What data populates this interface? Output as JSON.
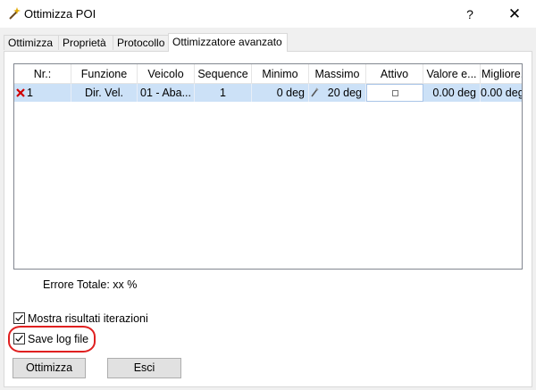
{
  "window": {
    "title": "Ottimizza POI",
    "help_glyph": "?",
    "close_glyph": "✕",
    "icon": "wand-icon"
  },
  "tabs": [
    {
      "label": "Ottimizza",
      "active": false
    },
    {
      "label": "Proprietà",
      "active": false
    },
    {
      "label": "Protocollo",
      "active": false
    },
    {
      "label": "Ottimizzatore avanzato",
      "active": true
    }
  ],
  "grid": {
    "columns": [
      "Nr.:",
      "Funzione",
      "Veicolo",
      "Sequence",
      "Minimo",
      "Massimo",
      "Attivo",
      "Valore e...",
      "Migliore..."
    ],
    "rows": [
      {
        "nr": "1",
        "funzione": "Dir. Vel.",
        "veicolo": "01 - Aba...",
        "sequence": "1",
        "minimo": "0 deg",
        "massimo": "20 deg",
        "attivo": true,
        "valore": "0.00 deg",
        "migliore": "0.00 deg",
        "selected": true
      }
    ]
  },
  "errore": {
    "label": "Errore Totale:",
    "value": "xx %"
  },
  "options": {
    "mostra_risultati": {
      "label": "Mostra risultati iterazioni",
      "checked": true
    },
    "save_log": {
      "label": "Save log file",
      "checked": true
    }
  },
  "buttons": {
    "ottimizza": "Ottimizza",
    "esci": "Esci"
  },
  "colors": {
    "selection": "#cce1f7",
    "highlight_ring": "#e02020",
    "delete_icon": "#d00000"
  }
}
